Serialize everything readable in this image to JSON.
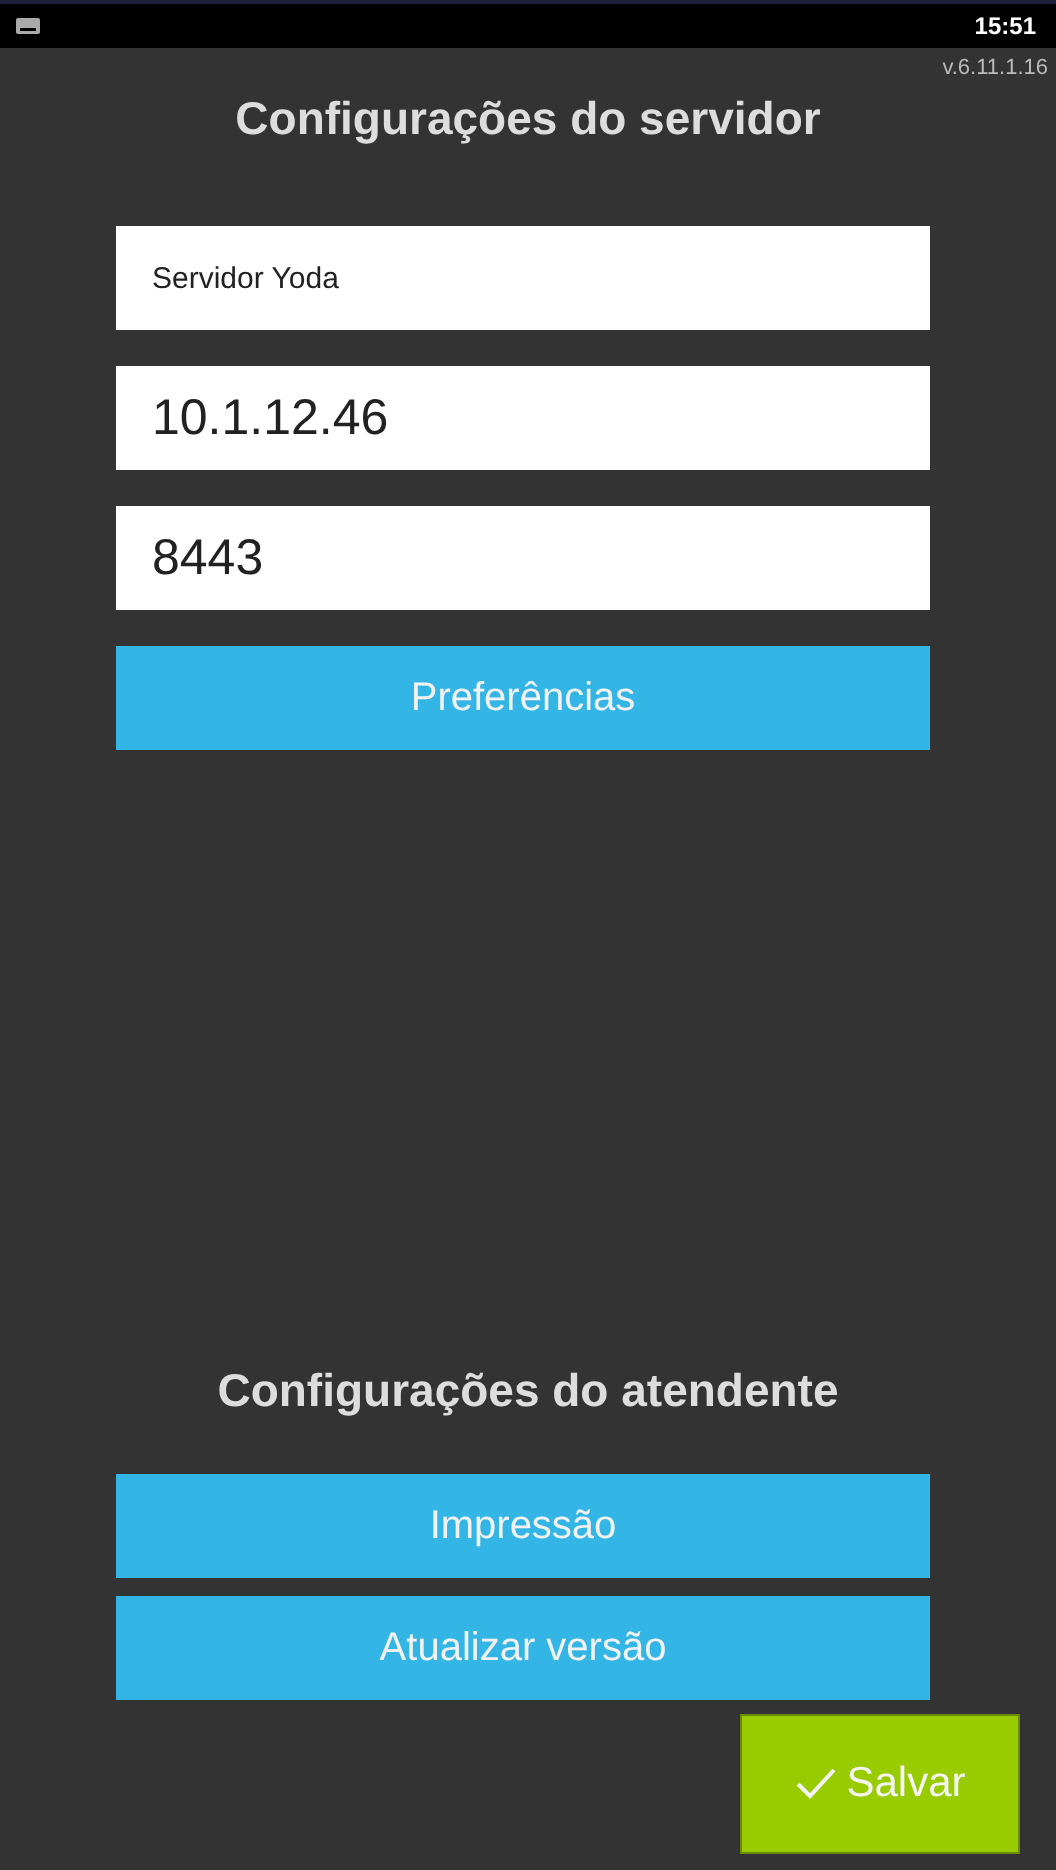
{
  "status_bar": {
    "time": "15:51"
  },
  "version": "v.6.11.1.16",
  "server_section": {
    "title": "Configurações do servidor",
    "fields": [
      {
        "value": "Servidor Yoda",
        "kind": "small"
      },
      {
        "value": "10.1.12.46",
        "kind": "large"
      },
      {
        "value": "8443",
        "kind": "large"
      }
    ],
    "button": "Preferências"
  },
  "attendant_section": {
    "title": "Configurações do atendente",
    "buttons": [
      "Impressão",
      "Atualizar versão"
    ]
  },
  "save_button": "Salvar"
}
